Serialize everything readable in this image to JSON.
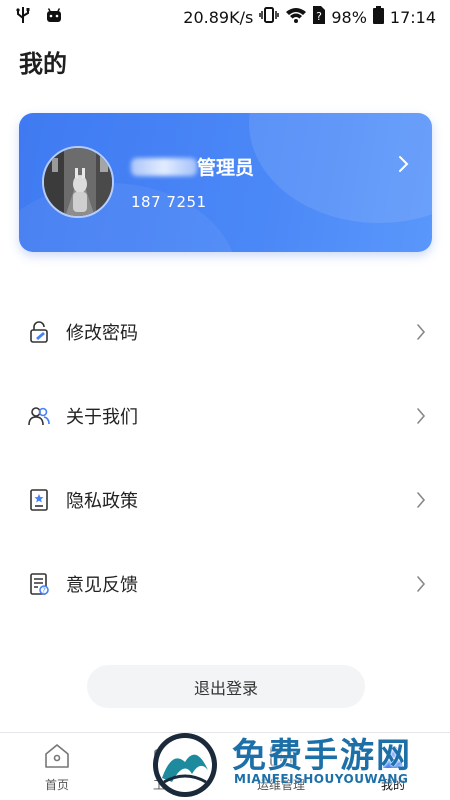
{
  "status_bar": {
    "speed": "20.89K/s",
    "battery": "98%",
    "time": "17:14"
  },
  "page": {
    "title": "我的"
  },
  "profile": {
    "name": "管理员",
    "phone": "187    7251"
  },
  "menu": {
    "items": [
      {
        "label": "修改密码",
        "icon": "lock-edit-icon"
      },
      {
        "label": "关于我们",
        "icon": "users-icon"
      },
      {
        "label": "隐私政策",
        "icon": "privacy-doc-icon"
      },
      {
        "label": "意见反馈",
        "icon": "feedback-doc-icon"
      }
    ]
  },
  "logout": {
    "label": "退出登录"
  },
  "tabbar": {
    "tabs": [
      {
        "label": "首页",
        "icon": "home-icon"
      },
      {
        "label": "工作",
        "icon": "work-icon"
      },
      {
        "label": "运维管理",
        "icon": "ops-icon"
      },
      {
        "label": "我的",
        "icon": "profile-icon"
      }
    ],
    "active_index": 3
  },
  "watermark": {
    "title": "免费手游网",
    "subtitle": "MIANFEISHOUYOUWANG"
  },
  "colors": {
    "accent": "#4582f5",
    "watermark": "#1d6fa8"
  }
}
